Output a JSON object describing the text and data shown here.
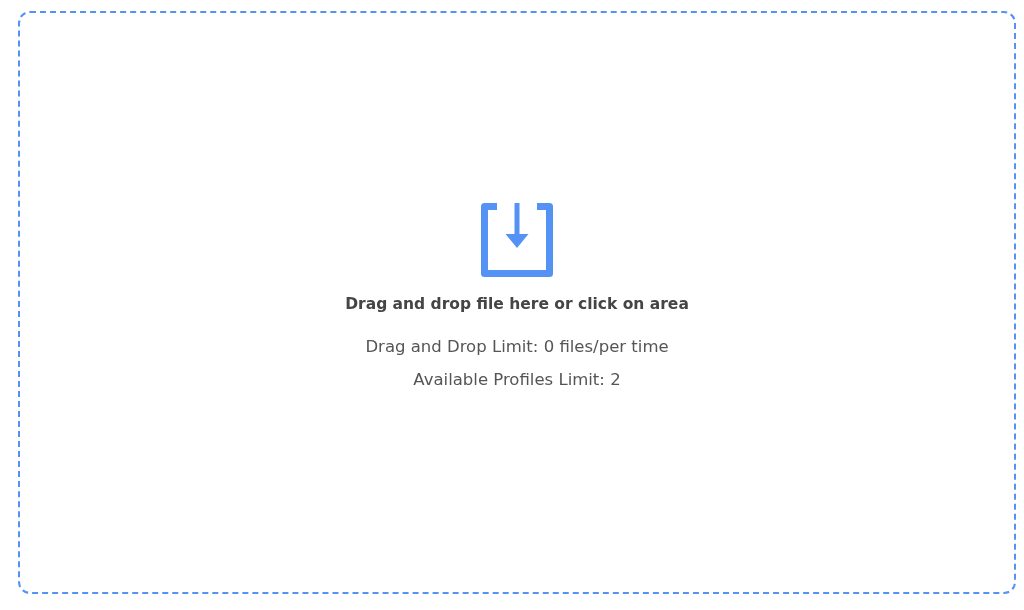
{
  "dropzone": {
    "instruction": "Drag and drop file here or click on area",
    "limits": [
      "Drag and Drop Limit: 0 files/per time",
      "Available Profiles Limit: 2"
    ]
  }
}
